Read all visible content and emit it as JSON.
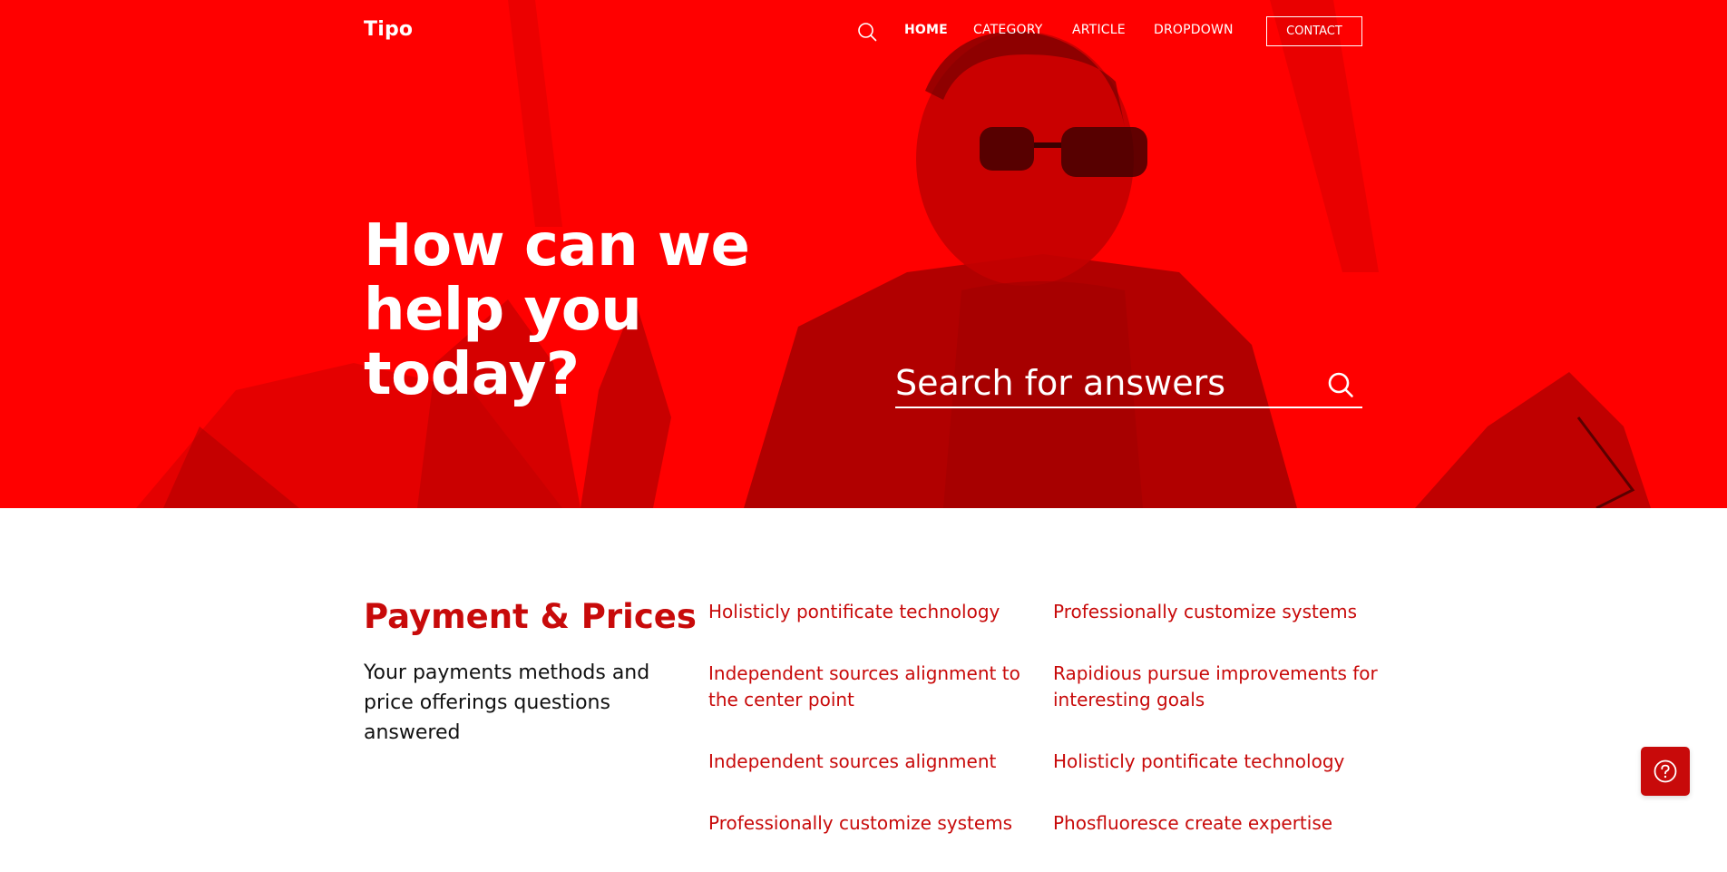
{
  "header": {
    "brand": "Tipo",
    "nav": [
      {
        "label": "HOME"
      },
      {
        "label": "CATEGORY"
      },
      {
        "label": "ARTICLE"
      },
      {
        "label": "DROPDOWN"
      }
    ],
    "contact_label": "CONTACT"
  },
  "hero": {
    "title_line1": "How can we",
    "title_line2": "help you",
    "title_line3": "today?",
    "search_placeholder": "Search for answers"
  },
  "section": {
    "title": "Payment & Prices",
    "description": "Your payments methods and price offerings questions answered",
    "links_col1": [
      "Holisticly pontificate technology",
      "Independent sources alignment to the center point",
      "Independent sources alignment",
      "Professionally customize systems"
    ],
    "links_col2": [
      "Professionally customize systems",
      "Rapidious pursue improvements for interesting goals",
      "Holisticly pontificate technology",
      "Phosfluoresce create expertise"
    ]
  },
  "icons": {
    "nav_search": "search-icon",
    "hero_search": "search-icon",
    "help": "question-circle-icon"
  },
  "colors": {
    "hero_bg": "#ff0000",
    "accent": "#c80a0a",
    "text": "#111111",
    "white": "#ffffff"
  }
}
